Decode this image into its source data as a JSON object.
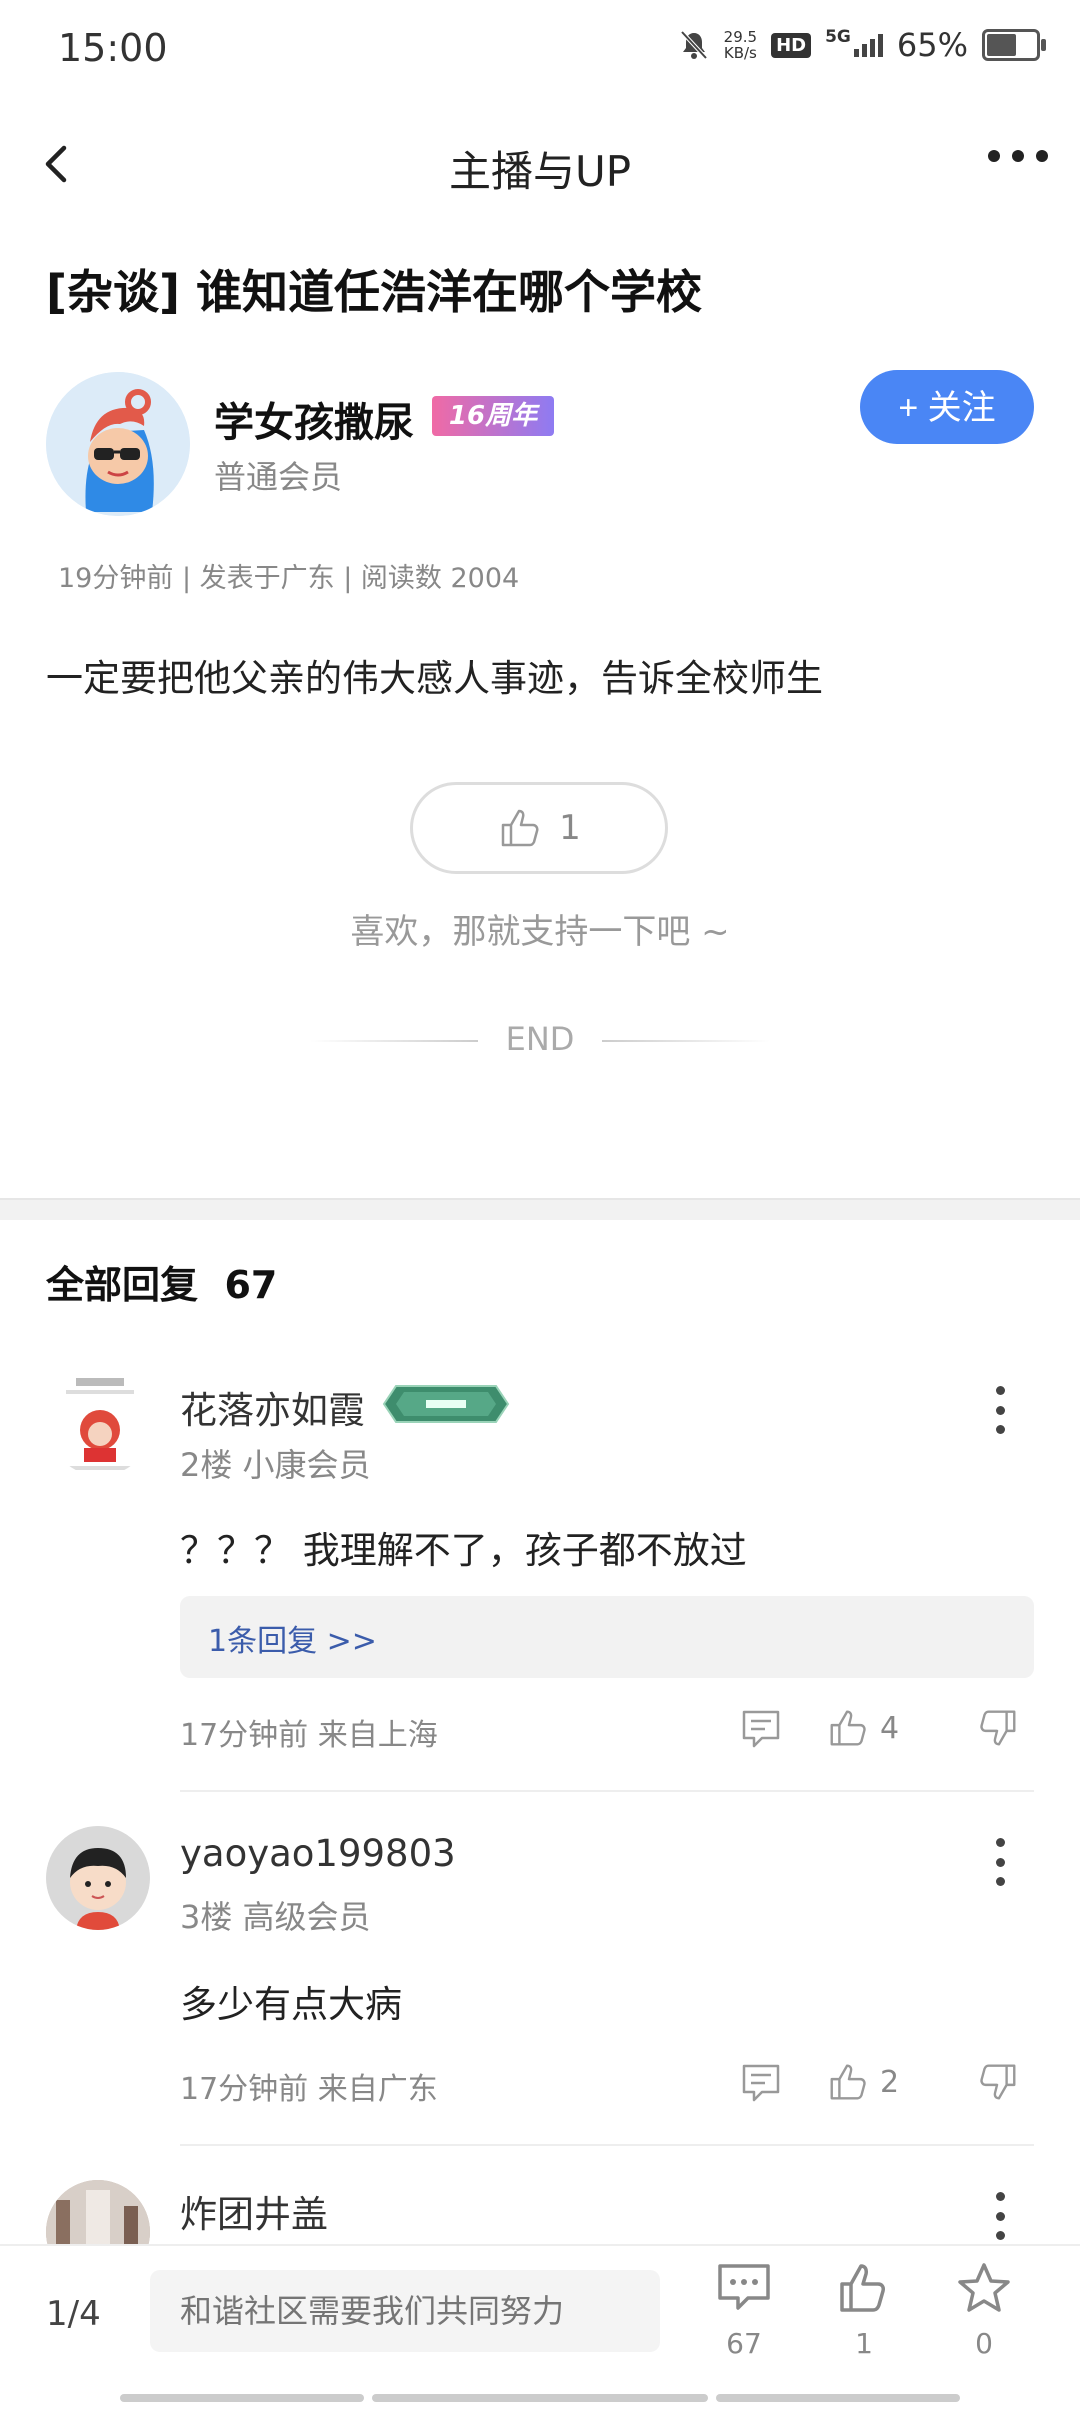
{
  "status_bar": {
    "time": "15:00",
    "net_speed_value": "29.5",
    "net_speed_unit": "KB/s",
    "hd": "HD",
    "network": "5G",
    "battery": "65%",
    "battery_level": 0.65
  },
  "nav": {
    "title": "主播与UP"
  },
  "post": {
    "title": "[杂谈] 谁知道任浩洋在哪个学校",
    "author": {
      "name": "学女孩撒尿",
      "badge": "16周年",
      "level": "普通会员"
    },
    "follow_label": "+ 关注",
    "meta": "19分钟前 | 发表于广东 | 阅读数 2004",
    "content": "一定要把他父亲的伟大感人事迹，告诉全校师生",
    "like_count": "1",
    "support_text": "喜欢，那就支持一下吧 ~",
    "end_text": "END"
  },
  "replies": {
    "title": "全部回复",
    "count": "67",
    "items": [
      {
        "name": "花落亦如霞",
        "floor_level": "2楼 小康会员",
        "body": "？？？ 我理解不了，孩子都不放过",
        "sub_replies": "1条回复 >>",
        "time_loc": "17分钟前 来自上海",
        "likes": "4"
      },
      {
        "name": "yaoyao199803",
        "floor_level": "3楼 高级会员",
        "body": "多少有点大病",
        "time_loc": "17分钟前 来自广东",
        "likes": "2"
      },
      {
        "name": "炸团井盖"
      }
    ]
  },
  "bottom_bar": {
    "page": "1/4",
    "input_placeholder": "和谐社区需要我们共同努力",
    "comments": "67",
    "likes": "1",
    "favorites": "0"
  }
}
